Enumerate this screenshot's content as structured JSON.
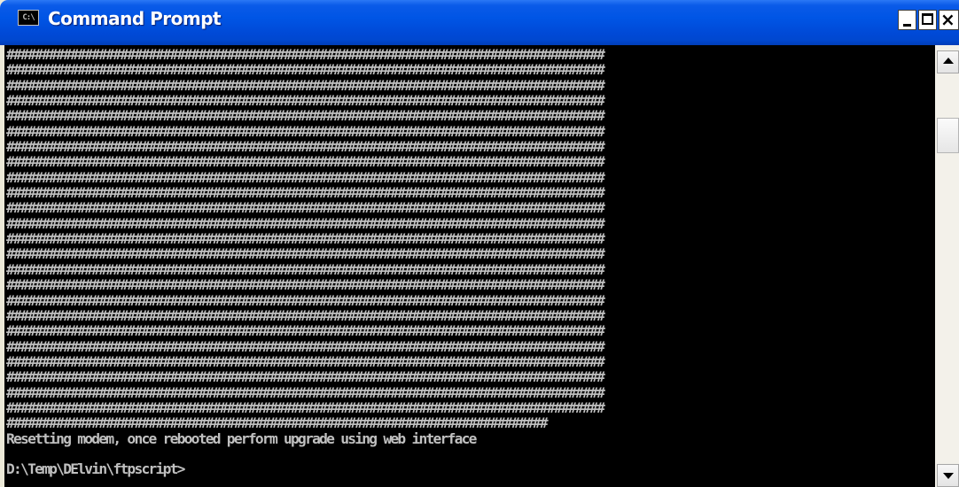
{
  "window": {
    "title": "Command Prompt",
    "icon_text": "C:\\",
    "controls": {
      "minimize": "minimize",
      "maximize": "maximize",
      "close": "×"
    }
  },
  "console": {
    "hash_line": "####################################################################################",
    "full_hash_lines": 24,
    "partial_hash_line": "############################################################################",
    "message": "Resetting modem, once rebooted perform upgrade using web interface",
    "blank": "",
    "prompt": "D:\\Temp\\DElvin\\ftpscript>"
  },
  "colors": {
    "title_bar": "#0055E5",
    "console_bg": "#000000",
    "console_text": "#C0C0C0"
  }
}
